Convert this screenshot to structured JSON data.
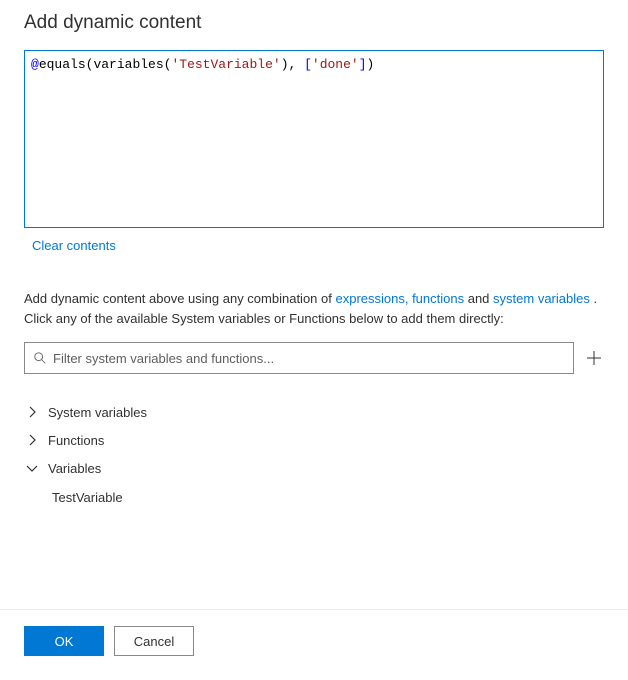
{
  "header": {
    "title": "Add dynamic content"
  },
  "editor": {
    "tokens": {
      "at": "@",
      "equals": "equals",
      "variables": "variables",
      "string1": "'TestVariable'",
      "string2": "'done'"
    },
    "clear_label": "Clear contents"
  },
  "help": {
    "prefix": "Add dynamic content above using any combination of ",
    "link1": "expressions, functions",
    "mid": " and ",
    "link2": "system variables",
    "suffix": " . Click any of the available System variables or Functions below to add them directly:"
  },
  "filter": {
    "placeholder": "Filter system variables and functions..."
  },
  "categories": {
    "system_variables": {
      "label": "System variables",
      "expanded": false
    },
    "functions": {
      "label": "Functions",
      "expanded": false
    },
    "variables": {
      "label": "Variables",
      "expanded": true,
      "items": [
        "TestVariable"
      ]
    }
  },
  "footer": {
    "ok": "OK",
    "cancel": "Cancel"
  }
}
